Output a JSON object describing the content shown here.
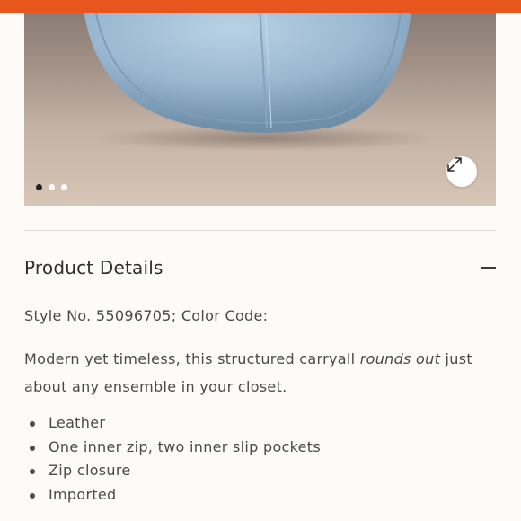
{
  "colors": {
    "accent_bar": "#e8561e",
    "background": "#fcfbf8",
    "bag_blue": "#9ab8d2"
  },
  "gallery": {
    "image_alt": "light blue leather round bag",
    "slide_count": 3,
    "active_slide": 1,
    "zoom_icon": "expand-icon"
  },
  "details": {
    "title": "Product Details",
    "toggle_icon": "minus-icon",
    "style_line": "Style No. 55096705; Color Code:",
    "description_before": "Modern yet timeless, this structured carryall ",
    "description_emphasis": "rounds out",
    "description_after": " just about any ensemble in your closet.",
    "features": [
      "Leather",
      "One inner zip, two inner slip pockets",
      "Zip closure",
      "Imported"
    ]
  }
}
